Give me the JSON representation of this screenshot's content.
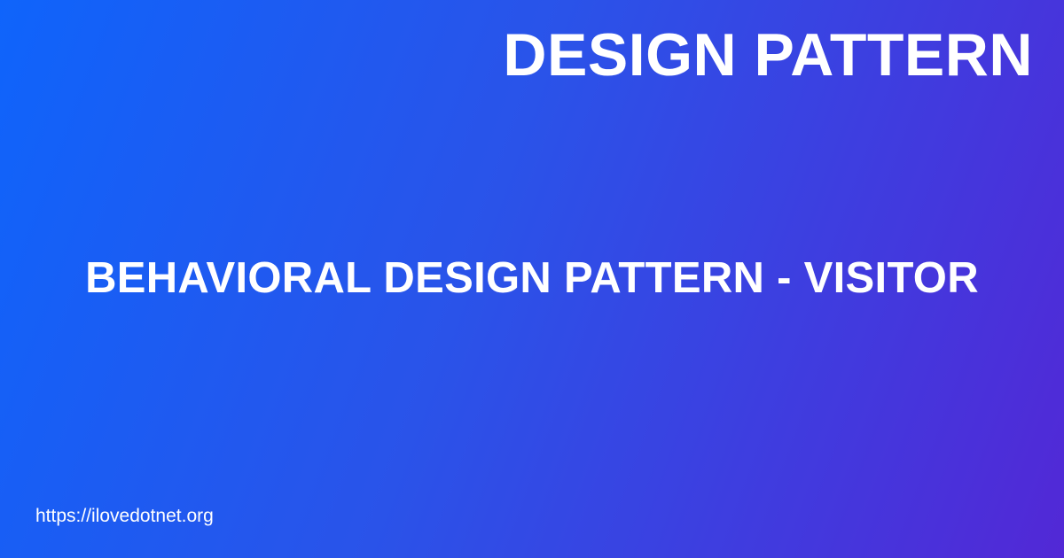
{
  "card": {
    "category": "DESIGN PATTERN",
    "title": "BEHAVIORAL DESIGN PATTERN - VISITOR",
    "site_url": "https://ilovedotnet.org"
  },
  "colors": {
    "gradient_start": "#0f64fb",
    "gradient_end": "#5228d6",
    "text": "#ffffff"
  }
}
